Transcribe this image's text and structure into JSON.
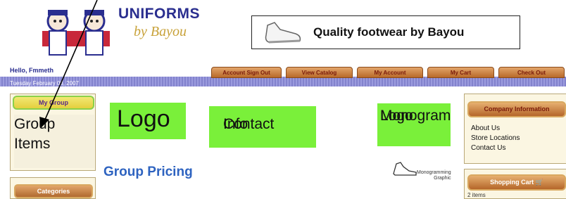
{
  "header": {
    "logo_text": "UNIFORMS",
    "logo_script": "by Bayou",
    "banner_text": "Quality footwear by Bayou"
  },
  "user": {
    "greeting": "Hello, Fmmeth",
    "date": "Tuesday February 06, 2007"
  },
  "nav": {
    "tabs": [
      {
        "label": "Account Sign Out"
      },
      {
        "label": "View Catalog"
      },
      {
        "label": "My Account"
      },
      {
        "label": "My Cart"
      },
      {
        "label": "Check Out"
      }
    ]
  },
  "left": {
    "my_group_label": "My Group",
    "group_items_line1": "Group",
    "group_items_line2": "Items",
    "categories_label": "Categories"
  },
  "main": {
    "logo_placeholder": "Logo",
    "contact_line1": "Contact",
    "contact_line2": "Info",
    "monogram_line1": "Monogram",
    "monogram_line2": "Logo",
    "group_pricing": "Group Pricing",
    "monogram_graphic_line1": "Monogramming",
    "monogram_graphic_line2": "Graphic"
  },
  "right": {
    "company_info_label": "Company Information",
    "links": [
      "About Us",
      "Store Locations",
      "Contact Us"
    ],
    "cart_label": "Shopping Cart",
    "cart_items": "2 items"
  },
  "colors": {
    "placeholder_green": "#7af03a",
    "nav_blue": "#8a8ad8",
    "tab_orange": "#c47a3a",
    "heading_blue": "#2e63c0"
  }
}
